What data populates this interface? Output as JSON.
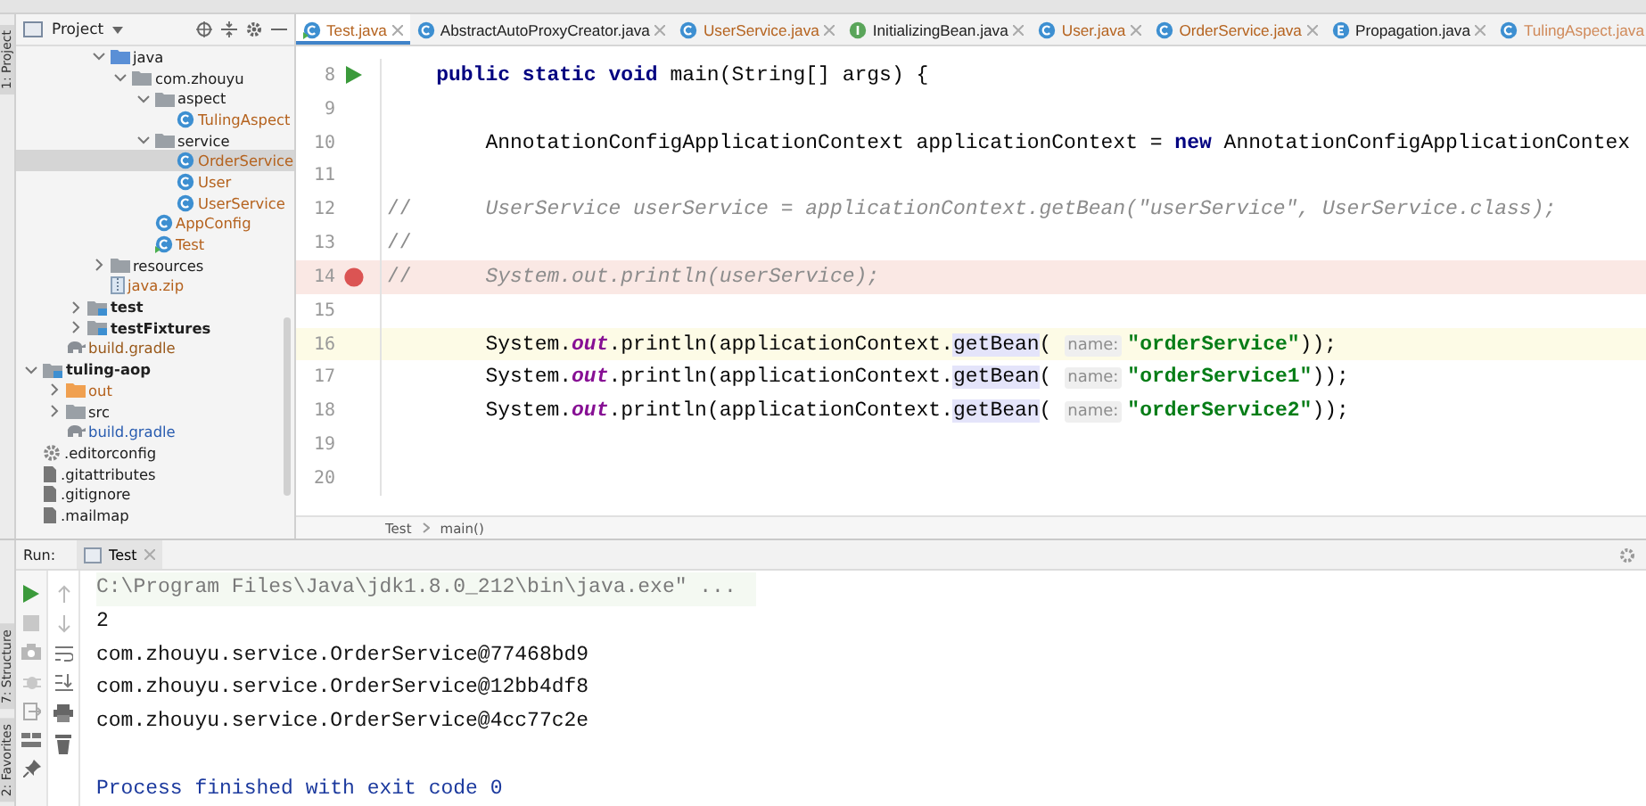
{
  "side_strip": {
    "top_label": "1: Project",
    "bottom_labels": [
      "7: Structure",
      "2: Favorites"
    ]
  },
  "project": {
    "title": "Project",
    "tree": [
      {
        "kind": "hidden",
        "children": [
          {
            "kind": "hidden",
            "children": [
              {
                "kind": "hidden",
                "children": [
                  {
                    "label": "java",
                    "kind": "source-folder",
                    "expanded": true,
                    "selected": false,
                    "color": "#202020",
                    "children": [
                      {
                        "label": "com.zhouyu",
                        "kind": "package",
                        "expanded": true,
                        "selected": false,
                        "color": "#202020",
                        "children": [
                          {
                            "label": "aspect",
                            "kind": "package",
                            "expanded": true,
                            "selected": false,
                            "color": "#202020",
                            "children": [
                              {
                                "label": "TulingAspect",
                                "kind": "class",
                                "selected": false,
                                "color": "#b5631f"
                              }
                            ]
                          },
                          {
                            "label": "service",
                            "kind": "package",
                            "expanded": true,
                            "selected": false,
                            "color": "#202020",
                            "children": [
                              {
                                "label": "OrderService",
                                "kind": "class",
                                "selected": true,
                                "color": "#b5631f"
                              },
                              {
                                "label": "User",
                                "kind": "class",
                                "selected": false,
                                "color": "#b5631f"
                              },
                              {
                                "label": "UserService",
                                "kind": "class",
                                "selected": false,
                                "color": "#b5631f"
                              }
                            ]
                          },
                          {
                            "label": "AppConfig",
                            "kind": "class",
                            "selected": false,
                            "color": "#b5631f"
                          },
                          {
                            "label": "Test",
                            "kind": "test-class",
                            "selected": false,
                            "color": "#b5631f"
                          }
                        ]
                      }
                    ]
                  },
                  {
                    "label": "resources",
                    "kind": "folder",
                    "expanded": false,
                    "selected": false,
                    "color": "#202020"
                  },
                  {
                    "label": "java.zip",
                    "kind": "zip",
                    "selected": false,
                    "color": "#b5631f"
                  }
                ]
              },
              {
                "label": "test",
                "kind": "source-root",
                "expanded": false,
                "selected": false,
                "color": "#202020"
              },
              {
                "label": "testFixtures",
                "kind": "source-root",
                "expanded": false,
                "selected": false,
                "color": "#202020"
              }
            ]
          },
          {
            "label": "build.gradle",
            "kind": "gradle",
            "selected": false,
            "color": "#9a5a1c"
          }
        ]
      },
      {
        "label": "tuling-aop",
        "kind": "module",
        "expanded": true,
        "selected": false,
        "color": "#202020",
        "children": [
          {
            "label": "out",
            "kind": "excluded",
            "expanded": false,
            "selected": false,
            "color": "#b5631f"
          },
          {
            "label": "src",
            "kind": "folder",
            "expanded": false,
            "selected": false,
            "color": "#202020"
          },
          {
            "label": "build.gradle",
            "kind": "gradle",
            "selected": false,
            "color": "#2a5db0"
          }
        ]
      },
      {
        "label": ".editorconfig",
        "kind": "config",
        "selected": false,
        "color": "#202020"
      },
      {
        "label": ".gitattributes",
        "kind": "git",
        "selected": false,
        "color": "#202020"
      },
      {
        "label": ".gitignore",
        "kind": "git",
        "selected": false,
        "color": "#202020"
      },
      {
        "label": ".mailmap",
        "kind": "git",
        "selected": false,
        "color": "#202020"
      }
    ]
  },
  "editor": {
    "tabs": [
      {
        "label": "Test.java",
        "kind": "test-class",
        "selected": true,
        "color": "#b5631f"
      },
      {
        "label": "AbstractAutoProxyCreator.java",
        "kind": "class",
        "selected": false,
        "color": "#202020"
      },
      {
        "label": "UserService.java",
        "kind": "class",
        "selected": false,
        "color": "#b5631f"
      },
      {
        "label": "InitializingBean.java",
        "kind": "interface",
        "selected": false,
        "color": "#202020"
      },
      {
        "label": "User.java",
        "kind": "class",
        "selected": false,
        "color": "#b5631f"
      },
      {
        "label": "OrderService.java",
        "kind": "class",
        "selected": false,
        "color": "#b5631f"
      },
      {
        "label": "Propagation.java",
        "kind": "enum",
        "selected": false,
        "color": "#202020"
      },
      {
        "label": "TulingAspect.java",
        "kind": "class",
        "selected": false,
        "color": "#d08a5a"
      }
    ],
    "lines": [
      {
        "number": "8",
        "runnable": true,
        "breakpoint": false,
        "current": false,
        "tokens": [
          {
            "text": "    public static void",
            "kind": "kw"
          },
          {
            "text": " main(String[] args) {",
            "kind": "plain"
          }
        ]
      },
      {
        "number": "9",
        "runnable": false,
        "breakpoint": false,
        "current": false
      },
      {
        "number": "10",
        "runnable": false,
        "breakpoint": false,
        "current": false,
        "tokens": [
          {
            "text": "        AnnotationConfigApplicationContext applicationContext = ",
            "kind": "plain"
          },
          {
            "text": "new",
            "kind": "kw"
          },
          {
            "text": " AnnotationConfigApplicationContex",
            "kind": "plain"
          }
        ]
      },
      {
        "number": "11",
        "runnable": false,
        "breakpoint": false,
        "current": false
      },
      {
        "number": "12",
        "runnable": false,
        "breakpoint": false,
        "current": false,
        "tokens": [
          {
            "text": "//",
            "kind": "slashes"
          },
          {
            "text": "      UserService userService = applicationContext.getBean(\"userService\", UserService.class);",
            "kind": "comment"
          }
        ]
      },
      {
        "number": "13",
        "runnable": false,
        "breakpoint": false,
        "current": false,
        "tokens": [
          {
            "text": "//",
            "kind": "slashes"
          }
        ]
      },
      {
        "number": "14",
        "runnable": false,
        "breakpoint": true,
        "current": false,
        "tokens": [
          {
            "text": "//",
            "kind": "slashes"
          },
          {
            "text": "      System.out.println(userService);",
            "kind": "comment"
          }
        ]
      },
      {
        "number": "15",
        "runnable": false,
        "breakpoint": false,
        "current": false
      },
      {
        "number": "16",
        "runnable": false,
        "breakpoint": false,
        "current": true,
        "tokens": [
          {
            "text": "        System.",
            "kind": "plain"
          },
          {
            "text": "out",
            "kind": "field"
          },
          {
            "text": ".println(applicationContext.",
            "kind": "plain"
          },
          {
            "text": "getBean",
            "kind": "ref"
          },
          {
            "text": "( ",
            "kind": "plain"
          },
          {
            "text": "name:",
            "kind": "hint"
          },
          {
            "text": "\"orderService\"",
            "kind": "str"
          },
          {
            "text": "));",
            "kind": "plain"
          }
        ]
      },
      {
        "number": "17",
        "runnable": false,
        "breakpoint": false,
        "current": false,
        "tokens": [
          {
            "text": "        System.",
            "kind": "plain"
          },
          {
            "text": "out",
            "kind": "field"
          },
          {
            "text": ".println(applicationContext.",
            "kind": "plain"
          },
          {
            "text": "getBean",
            "kind": "ref"
          },
          {
            "text": "( ",
            "kind": "plain"
          },
          {
            "text": "name:",
            "kind": "hint"
          },
          {
            "text": "\"orderService1\"",
            "kind": "str"
          },
          {
            "text": "));",
            "kind": "plain"
          }
        ]
      },
      {
        "number": "18",
        "runnable": false,
        "breakpoint": false,
        "current": false,
        "tokens": [
          {
            "text": "        System.",
            "kind": "plain"
          },
          {
            "text": "out",
            "kind": "field"
          },
          {
            "text": ".println(applicationContext.",
            "kind": "plain"
          },
          {
            "text": "getBean",
            "kind": "ref"
          },
          {
            "text": "( ",
            "kind": "plain"
          },
          {
            "text": "name:",
            "kind": "hint"
          },
          {
            "text": "\"orderService2\"",
            "kind": "str"
          },
          {
            "text": "));",
            "kind": "plain"
          }
        ]
      },
      {
        "number": "19",
        "runnable": false,
        "breakpoint": false,
        "current": false
      },
      {
        "number": "20",
        "runnable": false,
        "breakpoint": false,
        "current": false
      }
    ],
    "breadcrumb": [
      "Test",
      "main()"
    ]
  },
  "run": {
    "label": "Run:",
    "tabs": [
      {
        "label": "Test",
        "selected": true
      }
    ],
    "console": [
      {
        "kind": "command",
        "text": "C:\\Program Files\\Java\\jdk1.8.0_212\\bin\\java.exe\" ..."
      },
      {
        "kind": "output",
        "text": "2"
      },
      {
        "kind": "output",
        "text": "com.zhouyu.service.OrderService@77468bd9"
      },
      {
        "kind": "output",
        "text": "com.zhouyu.service.OrderService@12bb4df8"
      },
      {
        "kind": "output",
        "text": "com.zhouyu.service.OrderService@4cc77c2e"
      },
      {
        "kind": "exit",
        "text": "Process finished with exit code 0"
      }
    ]
  }
}
